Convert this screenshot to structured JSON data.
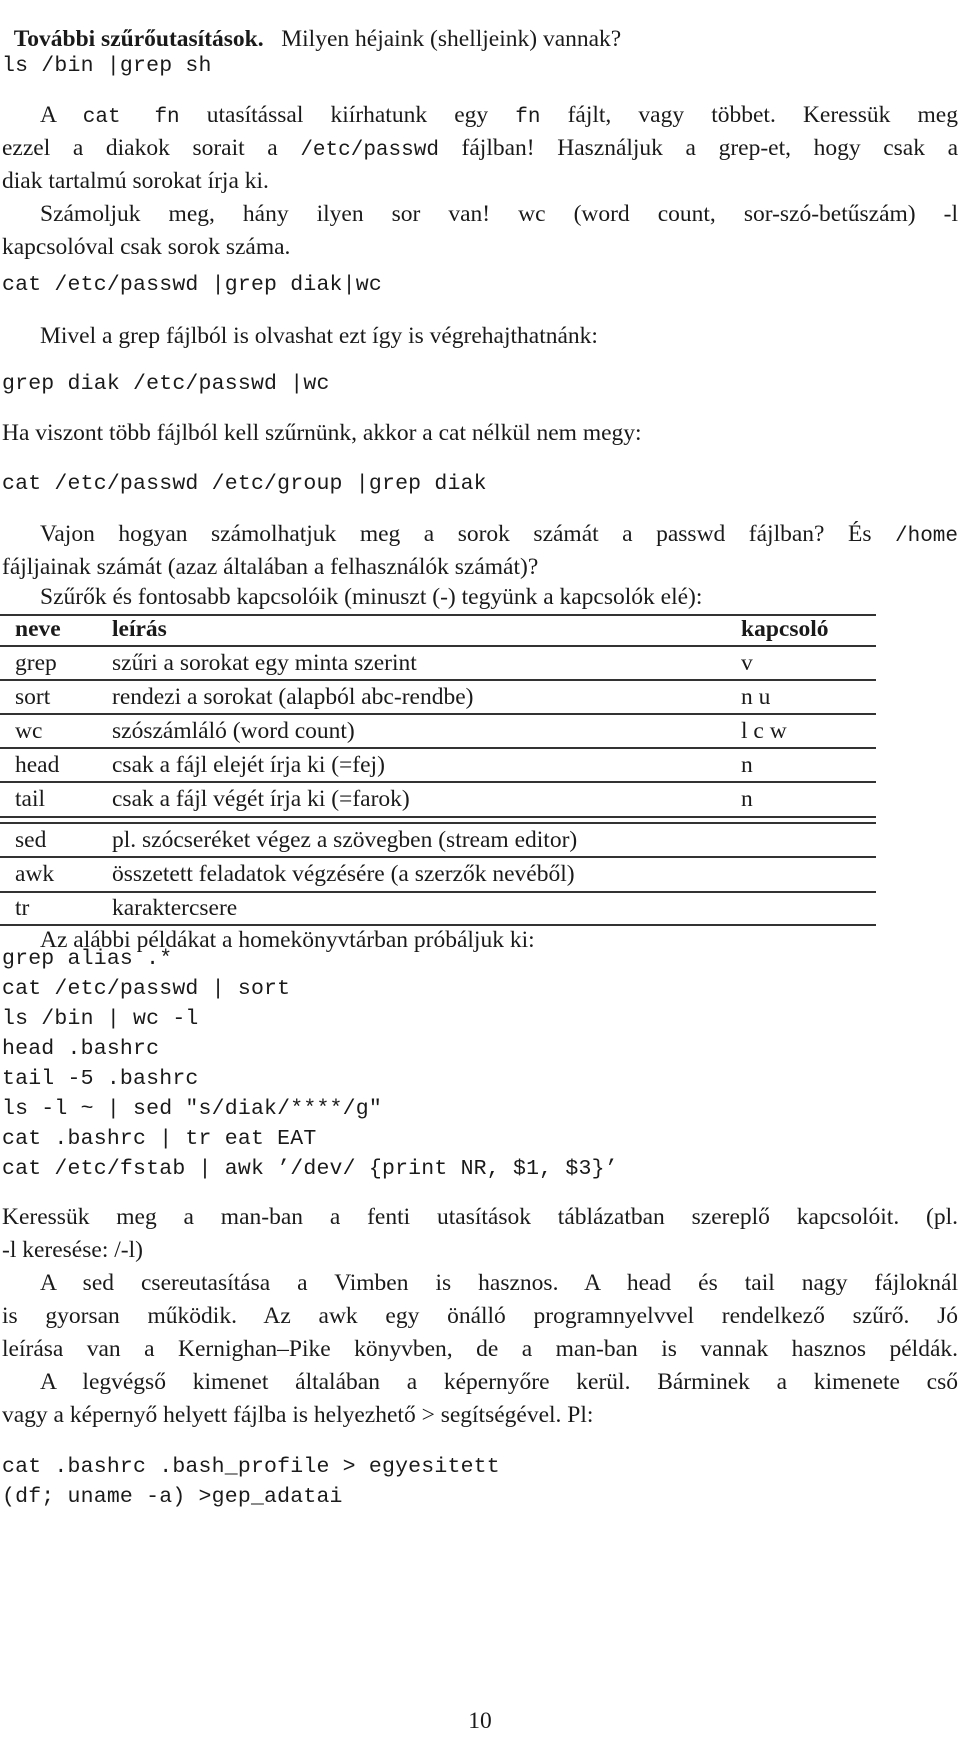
{
  "heading": {
    "title": "További szűrőutasítások.",
    "question": "Milyen héjaink (shelljeink) vannak?"
  },
  "commands": {
    "shells": "ls /bin |grep sh",
    "count_diak": "cat /etc/passwd |grep diak|wc",
    "grep_file": "grep diak /etc/passwd |wc",
    "multi_file": "cat /etc/passwd /etc/group |grep diak"
  },
  "paragraphs": {
    "cat_intro": {
      "parts": [
        "A ",
        "cat fn",
        " utasítással kiírhatunk egy ",
        "fn",
        " fájlt, vagy többet. Keressük meg"
      ],
      "line2_parts": [
        "ezzel a diakok sorait a ",
        "/etc/passwd",
        " fájlban! Használjuk a grep-et, hogy csak a"
      ],
      "line3": "diak tartalmú sorokat írja ki."
    },
    "count": {
      "line1": "Számoljuk meg, hány ilyen sor van! wc (word count, sor-szó-betűszám) -l",
      "line2": "kapcsolóval csak sorok száma."
    },
    "grep_reads_file": "Mivel a grep fájlból is olvashat ezt így is végrehajthatnánk:",
    "multi_file": "Ha viszont több fájlból kell szűrnünk, akkor a cat nélkül nem megy:",
    "question": {
      "line1_text": "Vajon hogyan számolhatjuk meg a sorok számát a passwd fájlban? És ",
      "line1_code": "/home",
      "line2": "fájljainak számát (azaz általában a felhasználók számát)?"
    },
    "filters_intro": "Szűrők és fontosabb kapcsolóik (minuszt (-) tegyünk a kapcsolók elé):",
    "examples_intro": "Az alábbi példákat a homekönyvtárban próbáljuk ki:",
    "man_search": {
      "line1": "Keressük meg a man-ban a fenti utasítások táblázatban szereplő kapcsolóit. (pl.",
      "line2": "-l keresése: /-l)"
    },
    "sed_note": {
      "line1": "A sed csereutasítása a Vimben is hasznos. A head és tail nagy fájloknál",
      "line2": "is gyorsan működik. Az awk egy önálló programnyelvvel rendelkező szűrő. Jó",
      "line3": "leírása van a Kernighan–Pike könyvben, de a man-ban is vannak hasznos példák."
    },
    "redirect": {
      "line1": "A legvégső kimenet általában a képernyőre kerül. Bárminek a kimenete cső",
      "line2": "vagy a képernyő helyett fájlba is helyezhető > segítségével. Pl:"
    }
  },
  "table": {
    "headers": [
      "neve",
      "leírás",
      "kapcsoló"
    ],
    "rows": [
      [
        "grep",
        "szűri a sorokat egy minta szerint",
        "v"
      ],
      [
        "sort",
        "rendezi a sorokat (alapból abc-rendbe)",
        "n u"
      ],
      [
        "wc",
        "szószámláló (word count)",
        "l c w"
      ],
      [
        "head",
        "csak a fájl elejét írja ki (=fej)",
        "n"
      ],
      [
        "tail",
        "csak a fájl végét írja ki (=farok)",
        "n"
      ],
      [
        "sed",
        "pl. szócseréket végez a szövegben (stream editor)",
        ""
      ],
      [
        "awk",
        "összetett feladatok végzésére (a szerzők nevéből)",
        ""
      ],
      [
        "tr",
        "karaktercsere",
        ""
      ]
    ]
  },
  "examples": [
    "grep alias .*",
    "cat /etc/passwd | sort",
    "ls /bin | wc -l",
    "head .bashrc",
    "tail -5 .bashrc",
    "ls -l ~ | sed \"s/diak/****/g\"",
    "cat .bashrc | tr eat EAT",
    "cat /etc/fstab | awk ’/dev/ {print NR, $1, $3}’"
  ],
  "redirect_examples": [
    "cat .bashrc .bash_profile > egyesitett",
    "(df; uname -a) >gep_adatai"
  ],
  "page_number": "10"
}
